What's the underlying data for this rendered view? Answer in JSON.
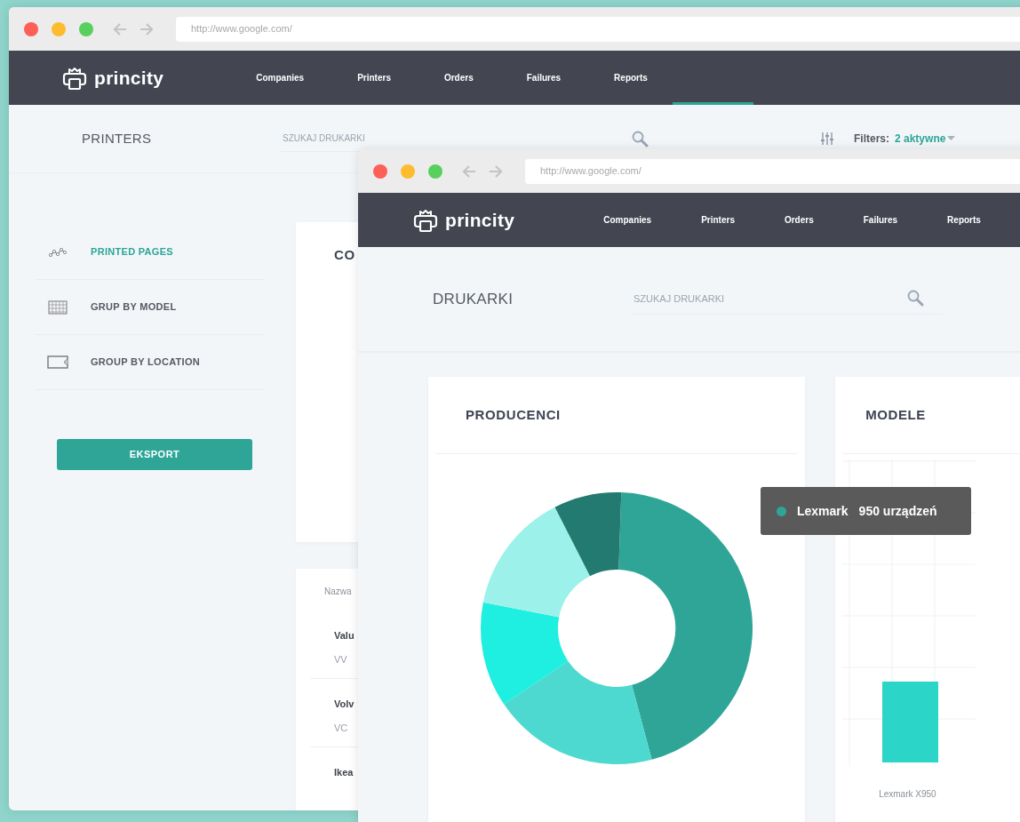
{
  "back_window": {
    "address": "http://www.google.com/",
    "brand": "princity",
    "nav": [
      {
        "label": "Companies"
      },
      {
        "label": "Printers"
      },
      {
        "label": "Orders"
      },
      {
        "label": "Failures"
      },
      {
        "label": "Reports"
      }
    ],
    "page_title": "PRINTERS",
    "search": {
      "placeholder": "SZUKAJ DRUKARKI"
    },
    "filters": {
      "label": "Filters:",
      "value": "2 aktywne"
    },
    "sidebar": {
      "items": [
        {
          "label": "PRINTED PAGES",
          "selected": true
        },
        {
          "label": "GRUP BY MODEL",
          "selected": false
        },
        {
          "label": "GROUP BY LOCATION",
          "selected": false
        }
      ]
    },
    "export_button": "EKSPORT",
    "card_title": "CO",
    "table": {
      "columns": [
        "Nazwa"
      ],
      "rows": [
        {
          "name": "Valu",
          "code": "VV"
        },
        {
          "name": "Volv",
          "code": "VC"
        },
        {
          "name": "Ikea"
        }
      ]
    }
  },
  "front_window": {
    "address": "http://www.google.com/",
    "brand": "princity",
    "nav": [
      {
        "label": "Companies"
      },
      {
        "label": "Printers"
      },
      {
        "label": "Orders"
      },
      {
        "label": "Failures"
      },
      {
        "label": "Reports"
      }
    ],
    "page_title": "DRUKARKI",
    "search": {
      "placeholder": "SZUKAJ DRUKARKI"
    },
    "cards": [
      {
        "title": "PRODUCENCI",
        "tooltip": {
          "label": "Lexmark",
          "value": "950 urządzeń",
          "color": "#2ea597"
        }
      },
      {
        "title": "MODELE",
        "bar_label": "Lexmark X950"
      }
    ]
  }
}
